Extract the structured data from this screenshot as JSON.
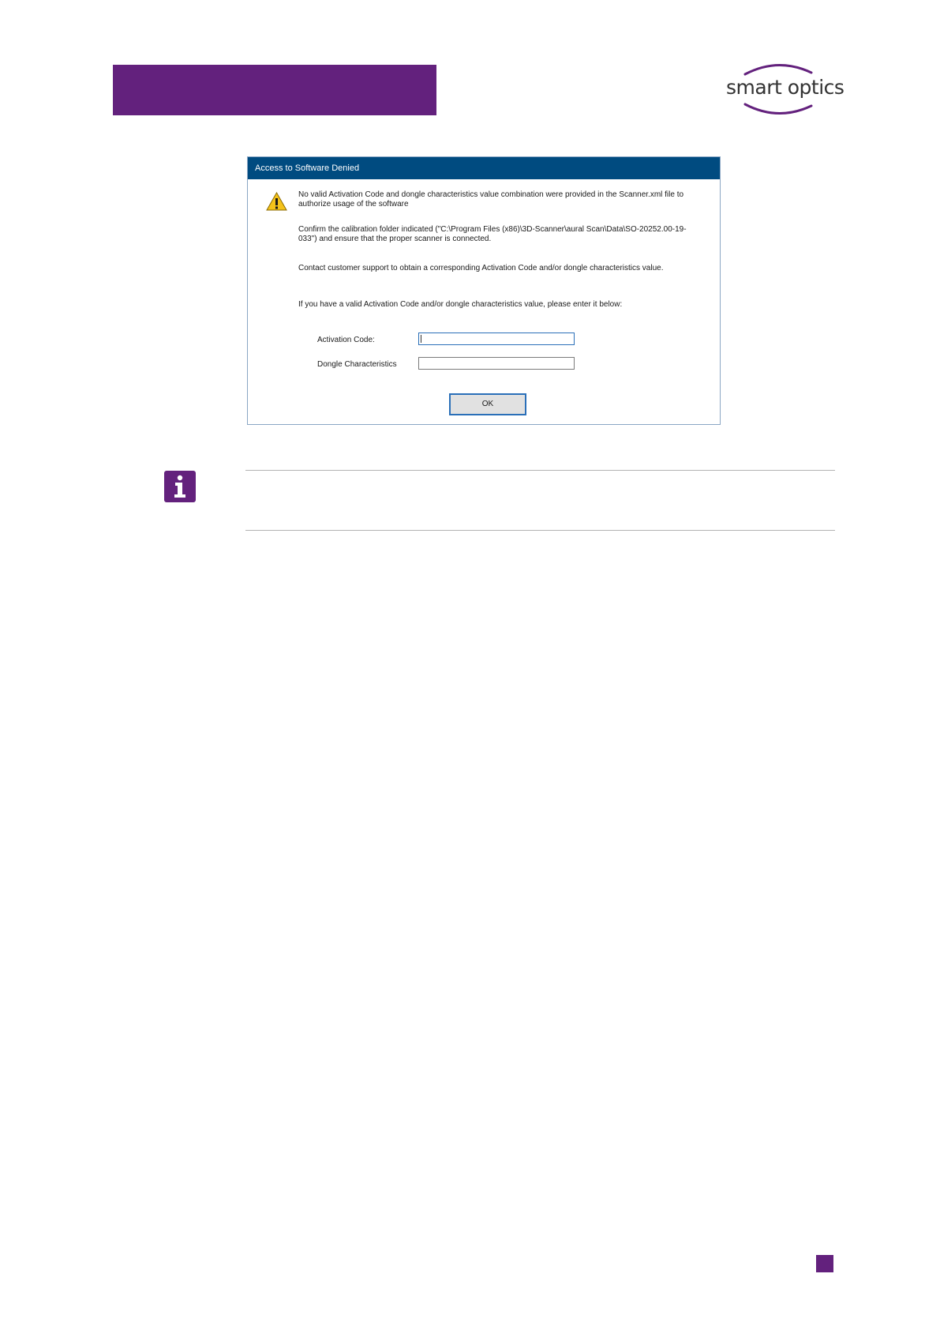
{
  "logo": {
    "text": "smart optics",
    "color": "#63217d"
  },
  "dialog": {
    "title": "Access to Software Denied",
    "message_1": "No valid Activation Code and dongle characteristics value combination were provided in the Scanner.xml file to authorize usage of the software",
    "message_2": "Confirm the calibration folder indicated (\"C:\\Program Files (x86)\\3D-Scanner\\aural Scan\\Data\\SO-20252.00-19-033\") and ensure that the proper scanner is connected.",
    "message_3": "Contact customer support to obtain a corresponding Activation Code and/or dongle characteristics value.",
    "message_4": "If you have a valid Activation Code and/or dongle characteristics value, please enter it below:",
    "activation_code_label": "Activation Code:",
    "activation_code_value": "",
    "dongle_label": "Dongle Characteristics",
    "dongle_value": "",
    "ok_label": "OK",
    "titlebar_color": "#004b80"
  },
  "icons": {
    "warning": "warning-triangle-icon",
    "info": "info-icon"
  },
  "brand_color": "#63217d"
}
